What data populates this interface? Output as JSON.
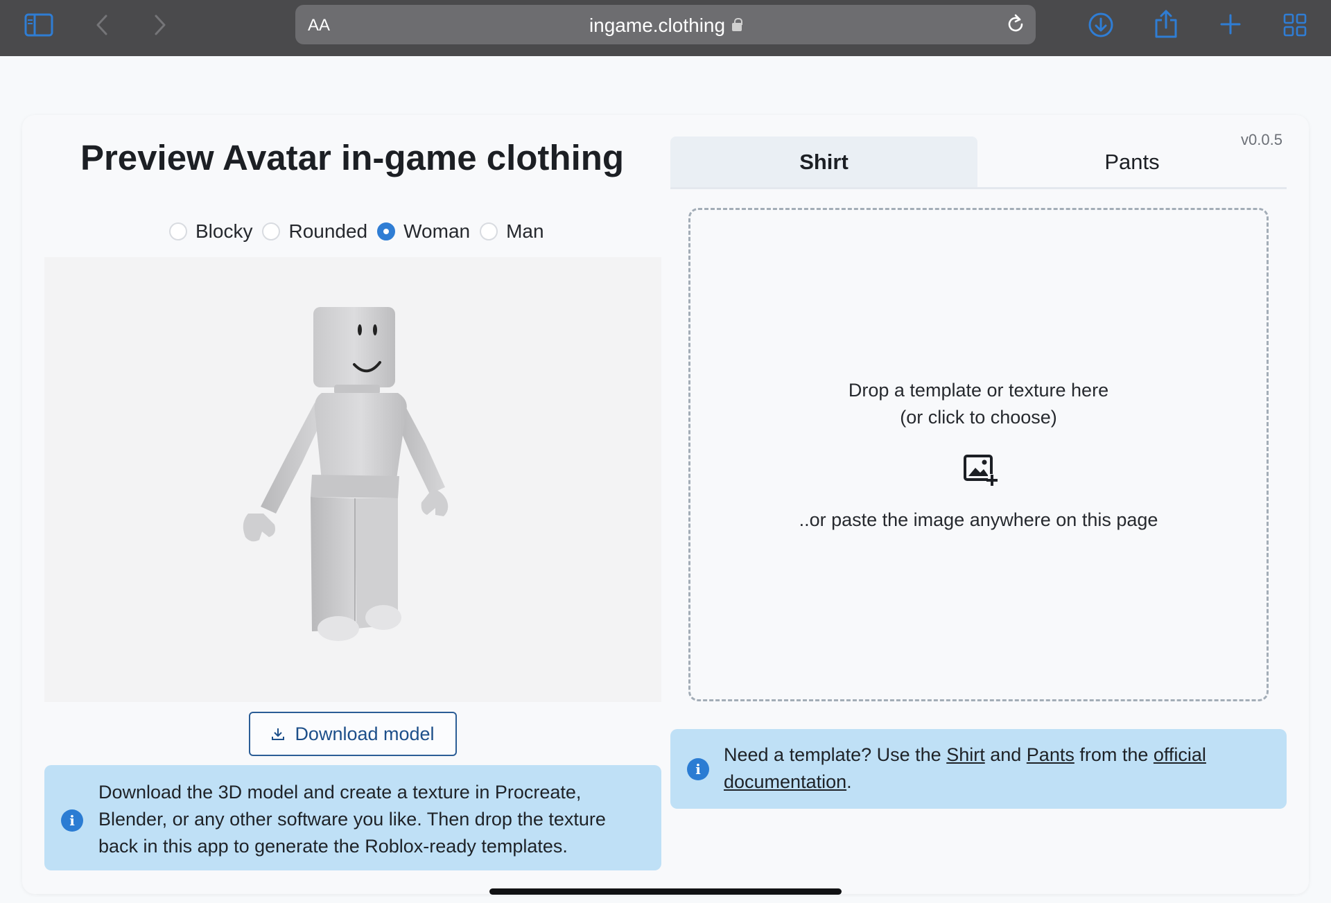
{
  "browser": {
    "text_size_label": "AA",
    "url": "ingame.clothing"
  },
  "page": {
    "title": "Preview Avatar in-game clothing",
    "version": "v0.0.5"
  },
  "body_types": {
    "options": [
      "Blocky",
      "Rounded",
      "Woman",
      "Man"
    ],
    "selected": "Woman"
  },
  "download_button": {
    "label": "Download model"
  },
  "left_info": {
    "text": "Download the 3D model and create a texture in Procreate, Blender, or any other software you like. Then drop the texture back in this app to generate the Roblox-ready templates."
  },
  "tabs": [
    {
      "label": "Shirt",
      "active": true
    },
    {
      "label": "Pants",
      "active": false
    }
  ],
  "dropzone": {
    "line1": "Drop a template or texture here",
    "line2": "(or click to choose)",
    "line3": "..or paste the image anywhere on this page"
  },
  "right_info": {
    "prefix": "Need a template? Use the ",
    "shirt_link": "Shirt",
    "and": " and ",
    "pants_link": "Pants",
    "from": " from the ",
    "official_link": "official",
    "documentation_link": "documentation",
    "suffix": "."
  },
  "colors": {
    "accent": "#2f7dd4",
    "info_background": "#bfe0f6",
    "toolbar": "#4a4a4c"
  },
  "icons": {
    "toolbar": [
      "sidebar-icon",
      "back-icon",
      "forward-icon",
      "reload-icon",
      "download-icon",
      "share-icon",
      "new-tab-icon",
      "tabs-overview-icon"
    ],
    "dropzone": "add-image-icon",
    "info": "info-icon"
  }
}
